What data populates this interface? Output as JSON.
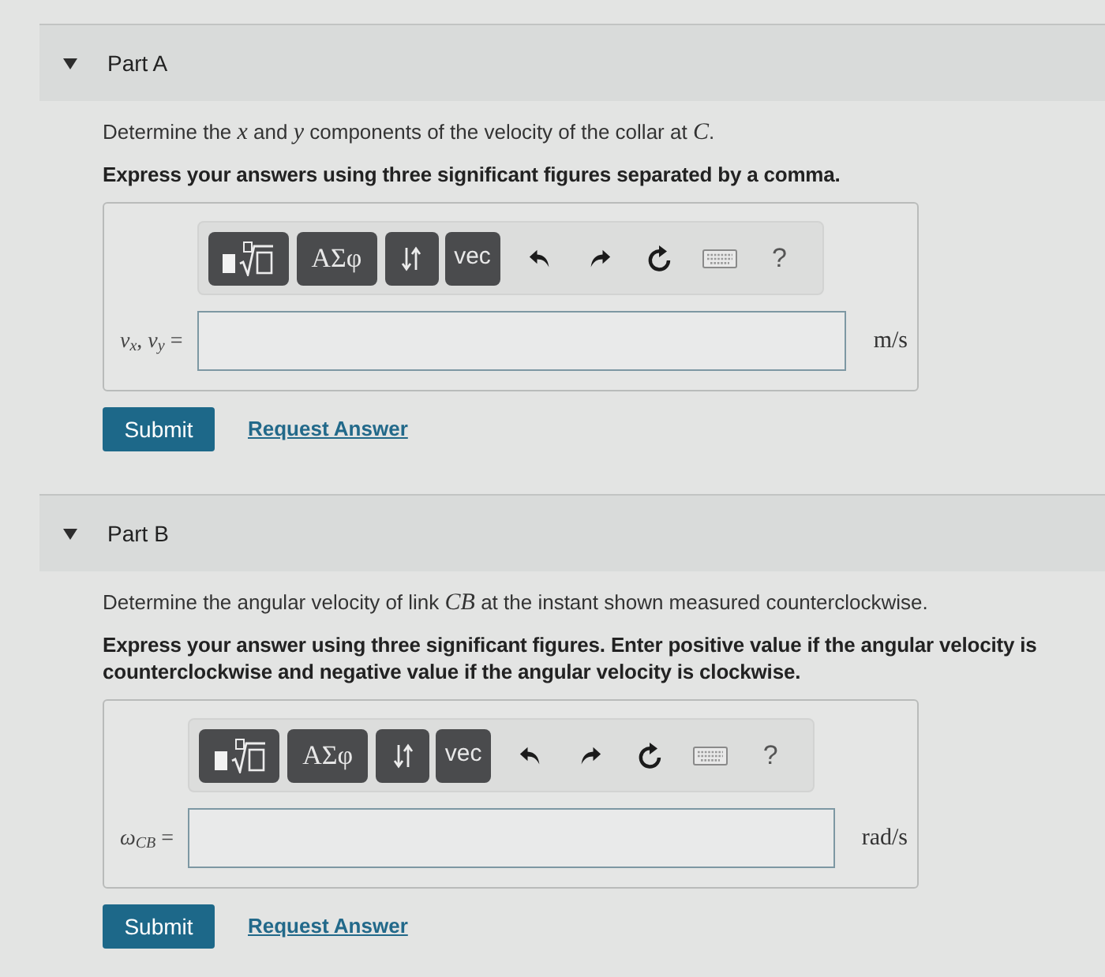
{
  "parts": [
    {
      "title": "Part A",
      "expanded": true,
      "question": "Determine the *x* and *y* components of the velocity of the collar at *C*.",
      "instruction": "Express your answers using three significant figures separated by a comma.",
      "toolbar": [
        {
          "kind": "templates"
        },
        {
          "kind": "symbols",
          "label": "ΑΣφ"
        },
        {
          "kind": "arrows"
        },
        {
          "kind": "vec",
          "label": "vec"
        },
        {
          "kind": "undo"
        },
        {
          "kind": "redo"
        },
        {
          "kind": "reset"
        },
        {
          "kind": "keyboard"
        },
        {
          "kind": "help",
          "label": "?"
        }
      ],
      "answer": {
        "label": "*v*$_{x}$, *v*$_{y}$ =",
        "unit": "m/s"
      },
      "submit": "Submit",
      "request_answer": "Request Answer"
    },
    {
      "title": "Part B",
      "expanded": true,
      "question": "Determine the angular velocity of link *CB* at the instant shown measured counterclockwise.",
      "instruction": "Express your answer using three significant figures. Enter positive value if the angular velocity is counterclockwise and negative value if the angular velocity is clockwise.",
      "toolbar": [
        {
          "kind": "templates"
        },
        {
          "kind": "symbols",
          "label": "ΑΣφ"
        },
        {
          "kind": "arrows"
        },
        {
          "kind": "vec",
          "label": "vec"
        },
        {
          "kind": "undo"
        },
        {
          "kind": "redo"
        },
        {
          "kind": "reset"
        },
        {
          "kind": "keyboard"
        },
        {
          "kind": "help",
          "label": "?"
        }
      ],
      "answer": {
        "label": "*ω*$_{CB}$ =",
        "unit": "rad/s"
      },
      "submit": "Submit",
      "request_answer": "Request Answer"
    }
  ]
}
